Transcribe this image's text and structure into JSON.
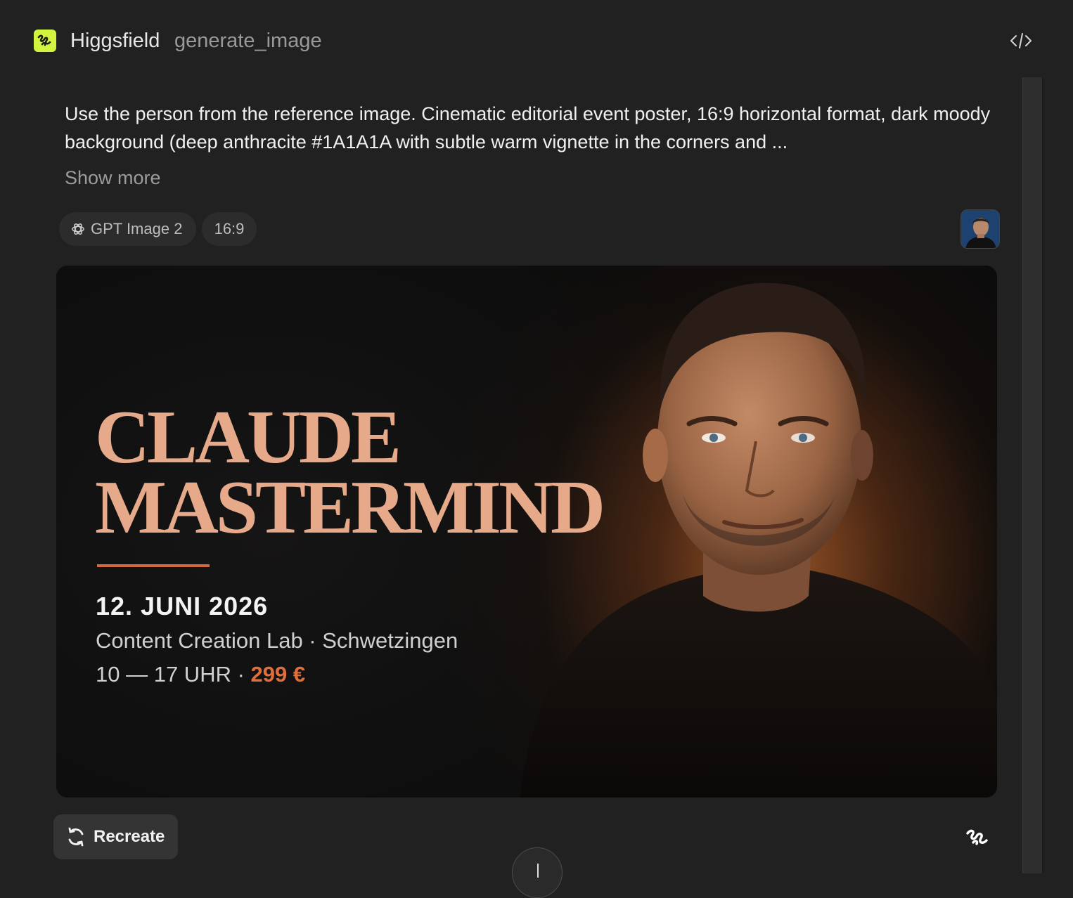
{
  "header": {
    "app_name": "Higgsfield",
    "tool_name": "generate_image",
    "code_toggle_icon": "code-icon"
  },
  "prompt": {
    "text": "Use the person from the reference image. Cinematic editorial event poster, 16:9 horizontal format, dark moody background (deep anthracite #1A1A1A with subtle warm vignette in the corners and ...",
    "show_more_label": "Show more"
  },
  "chips": {
    "model_label": "GPT Image 2",
    "model_icon": "openai-icon",
    "ratio_label": "16:9"
  },
  "poster": {
    "title_line1": "CLAUDE",
    "title_line2": "MASTERMIND",
    "date": "12. JUNI 2026",
    "venue": "Content Creation Lab · Schwetzingen",
    "time": "10 — 17 UHR · ",
    "price": "299 €",
    "colors": {
      "title": "#e6a98a",
      "accent": "#e06f3b",
      "rule": "#d06a3d",
      "background": "#0d0d0e"
    }
  },
  "actions": {
    "recreate_label": "Recreate",
    "recreate_icon": "refresh-icon",
    "brand_icon": "higgsfield-icon",
    "scroll_icon": "arrow-down-icon"
  },
  "colors": {
    "page_background": "#212121",
    "brand": "#d2f33f",
    "chip_background": "#2c2c2c"
  }
}
